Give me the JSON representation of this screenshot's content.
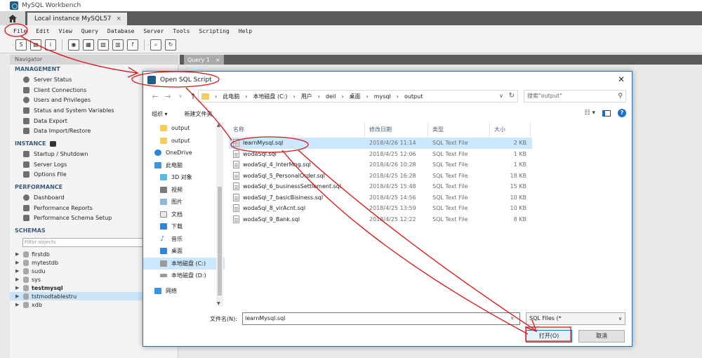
{
  "window": {
    "title": "MySQL Workbench",
    "connection_tab": "Local instance MySQL57",
    "close_glyph": "×"
  },
  "menu": [
    "File",
    "Edit",
    "View",
    "Query",
    "Database",
    "Server",
    "Tools",
    "Scripting",
    "Help"
  ],
  "navigator": {
    "header": "Navigator",
    "management_title": "MANAGEMENT",
    "management_items": [
      "Server Status",
      "Client Connections",
      "Users and Privileges",
      "Status and System Variables",
      "Data Export",
      "Data Import/Restore"
    ],
    "instance_title": "INSTANCE",
    "instance_items": [
      "Startup / Shutdown",
      "Server Logs",
      "Options File"
    ],
    "performance_title": "PERFORMANCE",
    "performance_items": [
      "Dashboard",
      "Performance Reports",
      "Performance Schema Setup"
    ],
    "schemas_title": "SCHEMAS",
    "filter_placeholder": "Filter objects",
    "schemas": [
      "firstdb",
      "mytestdb",
      "sudu",
      "sys",
      "testmysql",
      "tstmodtablestru",
      "xdb"
    ]
  },
  "query_tab": {
    "label": "Query 1",
    "close": "×"
  },
  "dialog": {
    "title": "Open SQL Script",
    "close": "✕",
    "path": [
      "此电脑",
      "本地磁盘 (C:)",
      "用户",
      "dell",
      "桌面",
      "mysql",
      "output"
    ],
    "search_placeholder": "搜索\"output\"",
    "organize": "组织 ▾",
    "new_folder": "新建文件夹",
    "tree": [
      "output",
      "output",
      "OneDrive",
      "此电脑",
      "3D 对象",
      "视频",
      "图片",
      "文档",
      "下载",
      "音乐",
      "桌面",
      "本地磁盘 (C:)",
      "本地磁盘 (D:)",
      "网络"
    ],
    "columns": {
      "name": "名称",
      "date": "修改日期",
      "type": "类型",
      "size": "大小"
    },
    "files": [
      {
        "name": "learnMysql.sql",
        "date": "2018/4/26 11:14",
        "type": "SQL Text File",
        "size": "2 KB"
      },
      {
        "name": "wodaSql.sql",
        "date": "2018/4/25 12:06",
        "type": "SQL Text File",
        "size": "1 KB"
      },
      {
        "name": "wodaSql_4_InterMng.sql",
        "date": "2018/4/26 10:28",
        "type": "SQL Text File",
        "size": "1 KB"
      },
      {
        "name": "wodaSql_5_PersonalOrder.sql",
        "date": "2018/4/25 16:28",
        "type": "SQL Text File",
        "size": "18 KB"
      },
      {
        "name": "wodaSql_6_businessSettlement.sql",
        "date": "2018/4/25 15:48",
        "type": "SQL Text File",
        "size": "15 KB"
      },
      {
        "name": "wodaSql_7_basicBisiness.sql",
        "date": "2018/4/25 14:56",
        "type": "SQL Text File",
        "size": "10 KB"
      },
      {
        "name": "wodaSql_8_virAcnt.sql",
        "date": "2018/4/25 13:59",
        "type": "SQL Text File",
        "size": "10 KB"
      },
      {
        "name": "wodaSql_9_Bank.sql",
        "date": "2018/4/25 12:22",
        "type": "SQL Text File",
        "size": "8 KB"
      }
    ],
    "filename_label": "文件名(N):",
    "filename_value": "learnMysql.sql",
    "filetype": "SQL Files (*",
    "open_button": "打开(O)",
    "cancel_button": "取消"
  },
  "colors": {
    "annotation": "#e01010",
    "selection": "#cce8ff",
    "accent": "#0078d7"
  }
}
